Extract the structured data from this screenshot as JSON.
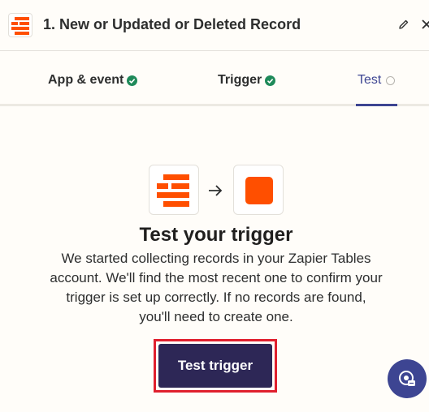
{
  "header": {
    "title": "1. New or Updated or Deleted Record",
    "app_icon": "zapier-tables-icon",
    "edit_icon": "pencil-icon",
    "close_icon": "close-icon"
  },
  "tabs": [
    {
      "label": "App & event",
      "status": "complete"
    },
    {
      "label": "Trigger",
      "status": "complete"
    },
    {
      "label": "Test",
      "status": "pending",
      "active": true
    }
  ],
  "main": {
    "heading": "Test your trigger",
    "description": "We started collecting records in your Zapier Tables account. We'll find the most recent one to confirm your trigger is set up correctly. If no records are found, you'll need to create one.",
    "button_label": "Test trigger"
  },
  "colors": {
    "accent": "#3d4592",
    "brand_orange": "#ff4f00",
    "button_bg": "#2d2756",
    "success": "#1f8a5a",
    "highlight": "#e0202e"
  }
}
